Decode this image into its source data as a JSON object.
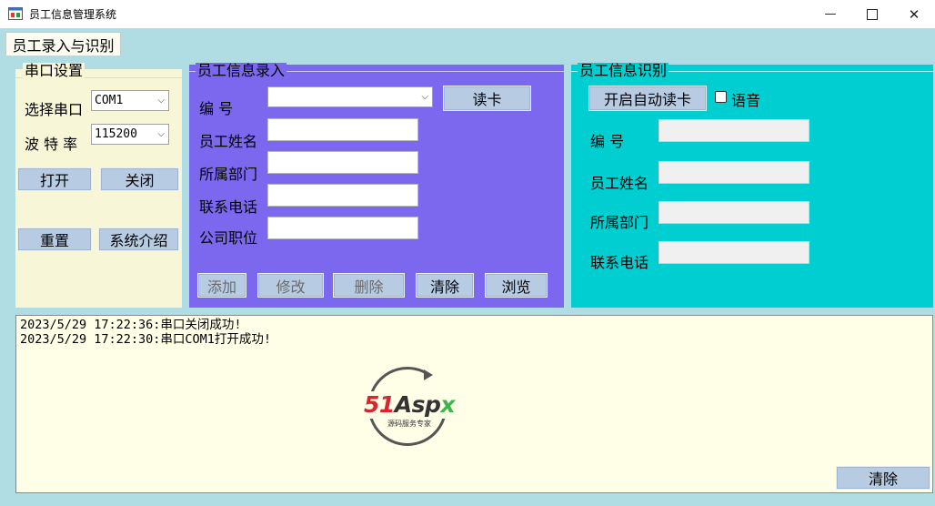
{
  "window": {
    "title": "员工信息管理系统",
    "minimize_glyph": "—",
    "maximize_glyph": "☐",
    "close_glyph": "✕"
  },
  "tabs": [
    {
      "label": "员工录入与识别",
      "selected": true
    }
  ],
  "serial": {
    "group_title": "串口设置",
    "port_label": "选择串口",
    "port_value": "COM1",
    "baud_label": "波 特 率",
    "baud_value": "115200",
    "open_label": "打开",
    "close_label": "关闭",
    "reset_label": "重置",
    "about_label": "系统介绍"
  },
  "entry": {
    "group_title": "员工信息录入",
    "id_label": "编    号",
    "name_label": "员工姓名",
    "dept_label": "所属部门",
    "phone_label": "联系电话",
    "position_label": "公司职位",
    "read_card_label": "读卡",
    "add_label": "添加",
    "modify_label": "修改",
    "delete_label": "删除",
    "clear_label": "清除",
    "browse_label": "浏览"
  },
  "recognize": {
    "group_title": "员工信息识别",
    "auto_read_label": "开启自动读卡",
    "voice_label": "语音",
    "voice_checked": false,
    "id_label": "编    号",
    "name_label": "员工姓名",
    "dept_label": "所属部门",
    "phone_label": "联系电话"
  },
  "log": {
    "lines": [
      "2023/5/29 17:22:36:串口关闭成功!",
      "2023/5/29 17:22:30:串口COM1打开成功!"
    ],
    "clear_label": "清除"
  },
  "watermark": {
    "brand": "51Aspx",
    "tagline": "源码服务专家"
  },
  "colors": {
    "tab_background": "#b0dde3",
    "serial_panel": "#f7f7d7",
    "entry_panel": "#7b68ee",
    "recognize_panel": "#00ced1",
    "log_background": "#ffffe8",
    "button": "#b7cbe3"
  }
}
